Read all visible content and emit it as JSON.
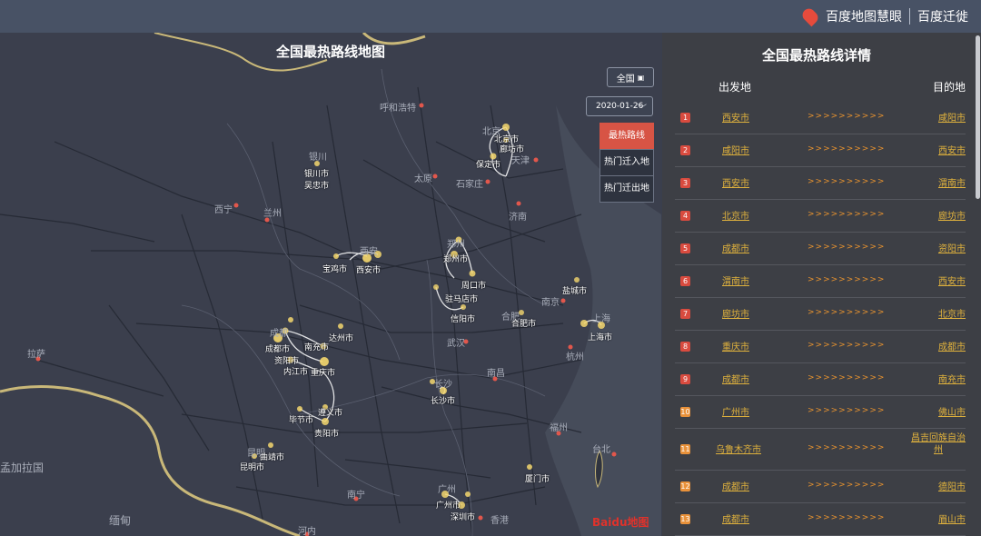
{
  "brand": {
    "logo": "百度地图慧眼",
    "product": "百度迁徙"
  },
  "map": {
    "title": "全国最热路线地图",
    "scope_label": "全国",
    "date": "2020-01-26",
    "modes": [
      {
        "label": "最热路线",
        "active": true
      },
      {
        "label": "热门迁入地",
        "active": false
      },
      {
        "label": "热门迁出地",
        "active": false
      }
    ],
    "watermark": "Baidu地图",
    "city_labels": [
      "北京市",
      "廊坊市",
      "保定市",
      "银川市",
      "吴忠市",
      "宝鸡市",
      "西安市",
      "郑州市",
      "周口市",
      "驻马店市",
      "信阳市",
      "合肥市",
      "盐城市",
      "上海市",
      "成都市",
      "南充市",
      "达州市",
      "资阳市",
      "内江市",
      "重庆市",
      "遵义市",
      "毕节市",
      "贵阳市",
      "长沙市",
      "曲靖市",
      "昆明市",
      "厦门市",
      "广州市",
      "深圳市"
    ],
    "background_labels": [
      "呼和浩特",
      "太原",
      "石家庄",
      "天津",
      "济南",
      "西宁",
      "兰州",
      "拉萨",
      "南京",
      "武汉",
      "南昌",
      "杭州",
      "福州",
      "台北",
      "南宁",
      "孟加拉国",
      "缅甸",
      "河内",
      "香港",
      "银川",
      "西安",
      "郑州",
      "北京",
      "成都",
      "长沙",
      "广州",
      "上海",
      "合肥",
      "昆明"
    ],
    "colors": {
      "route": "#ffffff",
      "city_dot": "#f5d76e",
      "capital_dot": "#e2574c",
      "border": "#c9b879",
      "road": "#252934",
      "land": "#3b3f4d"
    }
  },
  "panel": {
    "title": "全国最热路线详情",
    "col_origin": "出发地",
    "col_dest": "目的地",
    "arrows": ">>>>>>>>>>",
    "rows": [
      {
        "rank": "1",
        "origin": "西安市",
        "dest": "咸阳市"
      },
      {
        "rank": "2",
        "origin": "咸阳市",
        "dest": "西安市"
      },
      {
        "rank": "3",
        "origin": "西安市",
        "dest": "渭南市"
      },
      {
        "rank": "4",
        "origin": "北京市",
        "dest": "廊坊市"
      },
      {
        "rank": "5",
        "origin": "成都市",
        "dest": "资阳市"
      },
      {
        "rank": "6",
        "origin": "渭南市",
        "dest": "西安市"
      },
      {
        "rank": "7",
        "origin": "廊坊市",
        "dest": "北京市"
      },
      {
        "rank": "8",
        "origin": "重庆市",
        "dest": "成都市"
      },
      {
        "rank": "9",
        "origin": "成都市",
        "dest": "南充市"
      },
      {
        "rank": "10",
        "origin": "广州市",
        "dest": "佛山市"
      },
      {
        "rank": "11",
        "origin": "乌鲁木齐市",
        "dest": "昌吉回族自治州"
      },
      {
        "rank": "12",
        "origin": "成都市",
        "dest": "德阳市"
      },
      {
        "rank": "13",
        "origin": "成都市",
        "dest": "眉山市"
      }
    ]
  }
}
